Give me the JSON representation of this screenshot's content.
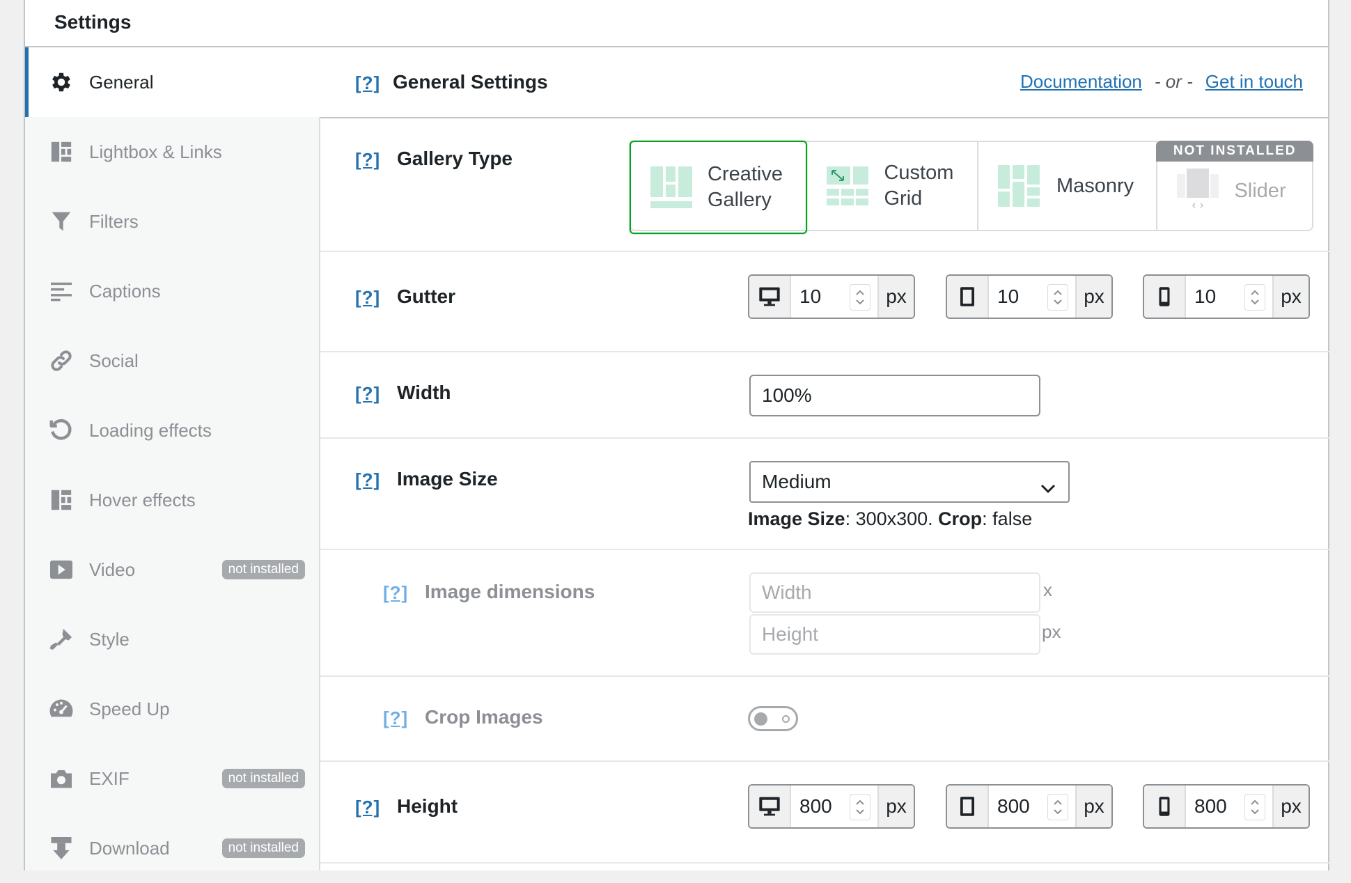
{
  "title": "Settings",
  "sidebar": {
    "items": [
      {
        "label": "General",
        "icon": "gear-icon",
        "badge": ""
      },
      {
        "label": "Lightbox & Links",
        "icon": "grid-icon",
        "badge": ""
      },
      {
        "label": "Filters",
        "icon": "funnel-icon",
        "badge": ""
      },
      {
        "label": "Captions",
        "icon": "text-lines-icon",
        "badge": ""
      },
      {
        "label": "Social",
        "icon": "link-icon",
        "badge": ""
      },
      {
        "label": "Loading effects",
        "icon": "refresh-icon",
        "badge": ""
      },
      {
        "label": "Hover effects",
        "icon": "grid-icon",
        "badge": ""
      },
      {
        "label": "Video",
        "icon": "play-icon",
        "badge": "not installed"
      },
      {
        "label": "Style",
        "icon": "brush-icon",
        "badge": ""
      },
      {
        "label": "Speed Up",
        "icon": "gauge-icon",
        "badge": ""
      },
      {
        "label": "EXIF",
        "icon": "camera-icon",
        "badge": "not installed"
      },
      {
        "label": "Download",
        "icon": "download-icon",
        "badge": "not installed"
      }
    ]
  },
  "header": {
    "help": "[?]",
    "title": "General Settings",
    "doc_link": "Documentation",
    "or_text": "- or -",
    "contact_link": "Get in touch"
  },
  "gallery_type": {
    "help": "[?]",
    "label": "Gallery Type",
    "options": [
      {
        "label_line1": "Creative",
        "label_line2": "Gallery",
        "selected": true
      },
      {
        "label_line1": "Custom",
        "label_line2": "Grid",
        "selected": false
      },
      {
        "label_line1": "Masonry",
        "label_line2": "",
        "selected": false
      },
      {
        "label_line1": "Slider",
        "label_line2": "",
        "selected": false,
        "badge": "NOT INSTALLED"
      }
    ]
  },
  "gutter": {
    "help": "[?]",
    "label": "Gutter",
    "desktop": "10",
    "tablet": "10",
    "mobile": "10",
    "unit": "px"
  },
  "width": {
    "help": "[?]",
    "label": "Width",
    "value": "100%"
  },
  "image_size": {
    "help": "[?]",
    "label": "Image Size",
    "selected": "Medium",
    "note_label1": "Image Size",
    "note_value1": ": 300x300. ",
    "note_label2": "Crop",
    "note_value2": ": false"
  },
  "image_dimensions": {
    "help": "[?]",
    "label": "Image dimensions",
    "width_placeholder": "Width",
    "height_placeholder": "Height",
    "x_suffix": "x",
    "px_suffix": "px"
  },
  "crop_images": {
    "help": "[?]",
    "label": "Crop Images",
    "enabled": false
  },
  "height": {
    "help": "[?]",
    "label": "Height",
    "desktop": "800",
    "tablet": "800",
    "mobile": "800",
    "unit": "px"
  },
  "colors": {
    "accent": "#2271b1",
    "selected_border": "#00a32a",
    "gallery_icon": "#c8ecdc"
  }
}
